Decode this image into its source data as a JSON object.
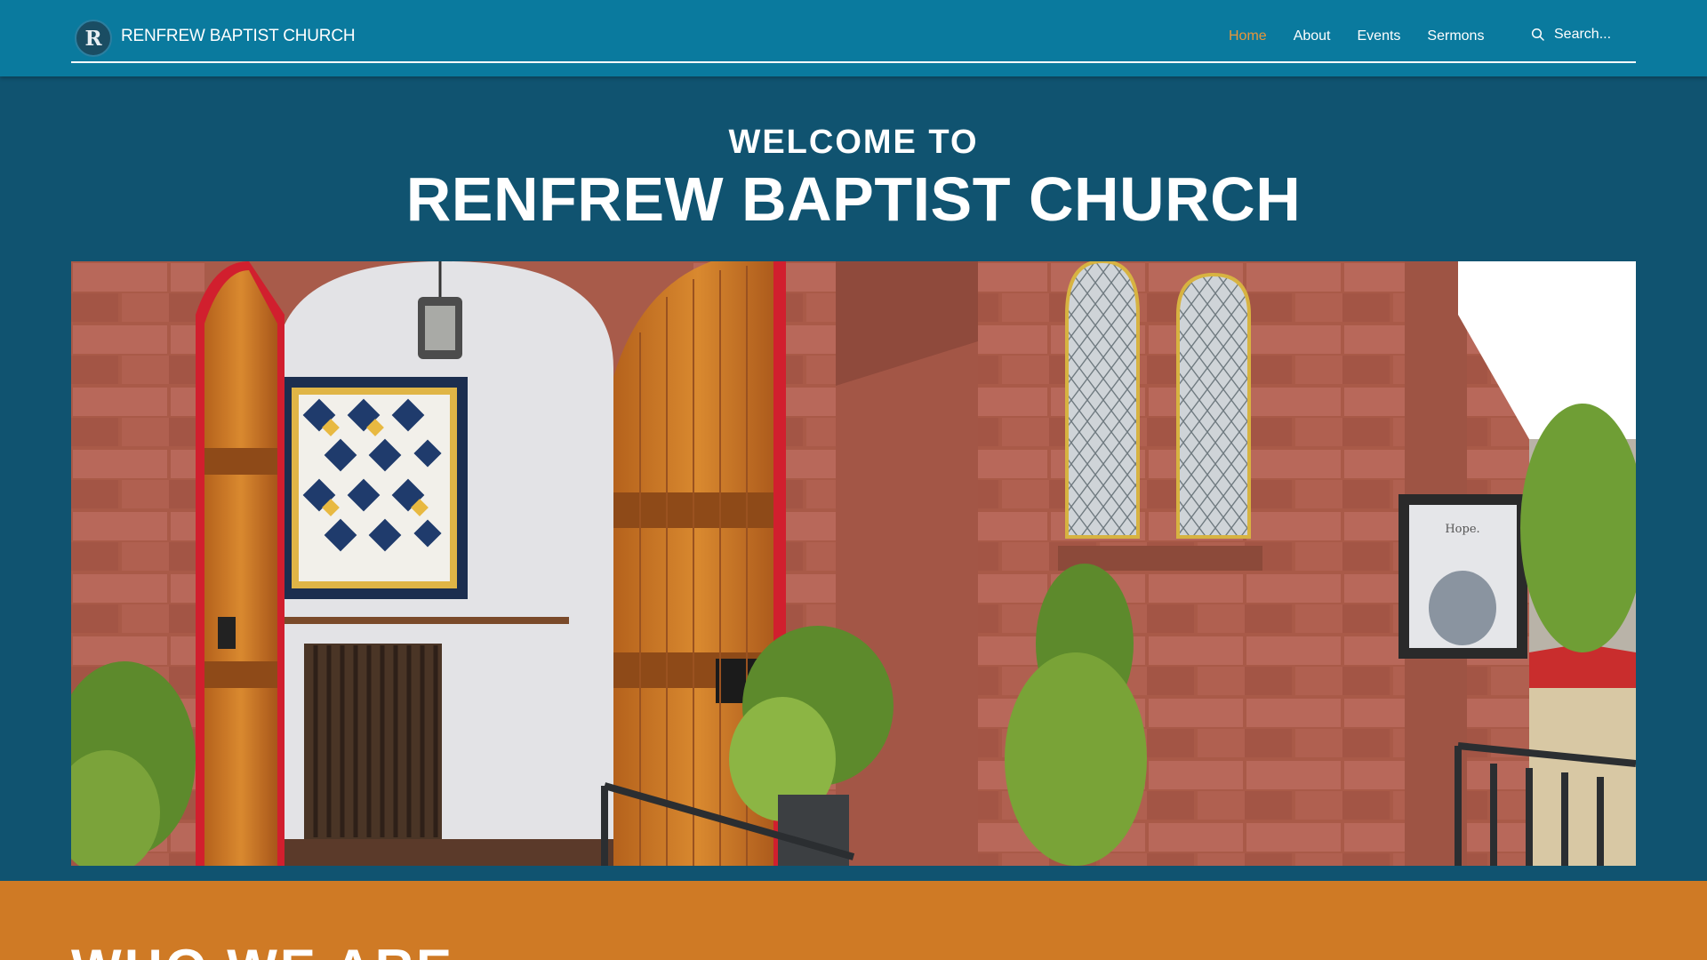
{
  "header": {
    "logo_letter": "R",
    "site_name": "RENFREW BAPTIST CHURCH",
    "nav": [
      {
        "label": "Home",
        "active": true
      },
      {
        "label": "About",
        "active": false
      },
      {
        "label": "Events",
        "active": false
      },
      {
        "label": "Sermons",
        "active": false
      }
    ],
    "search_placeholder": "Search..."
  },
  "hero": {
    "welcome_line": "WELCOME TO",
    "church_name": "RENFREW BAPTIST CHURCH",
    "photo_poster_text": "Hope."
  },
  "who_section": {
    "title": "WHO WE ARE"
  },
  "colors": {
    "header_bg": "#0a7a9e",
    "page_bg": "#105370",
    "accent_orange": "#cf7a25",
    "nav_active": "#e8963a"
  }
}
